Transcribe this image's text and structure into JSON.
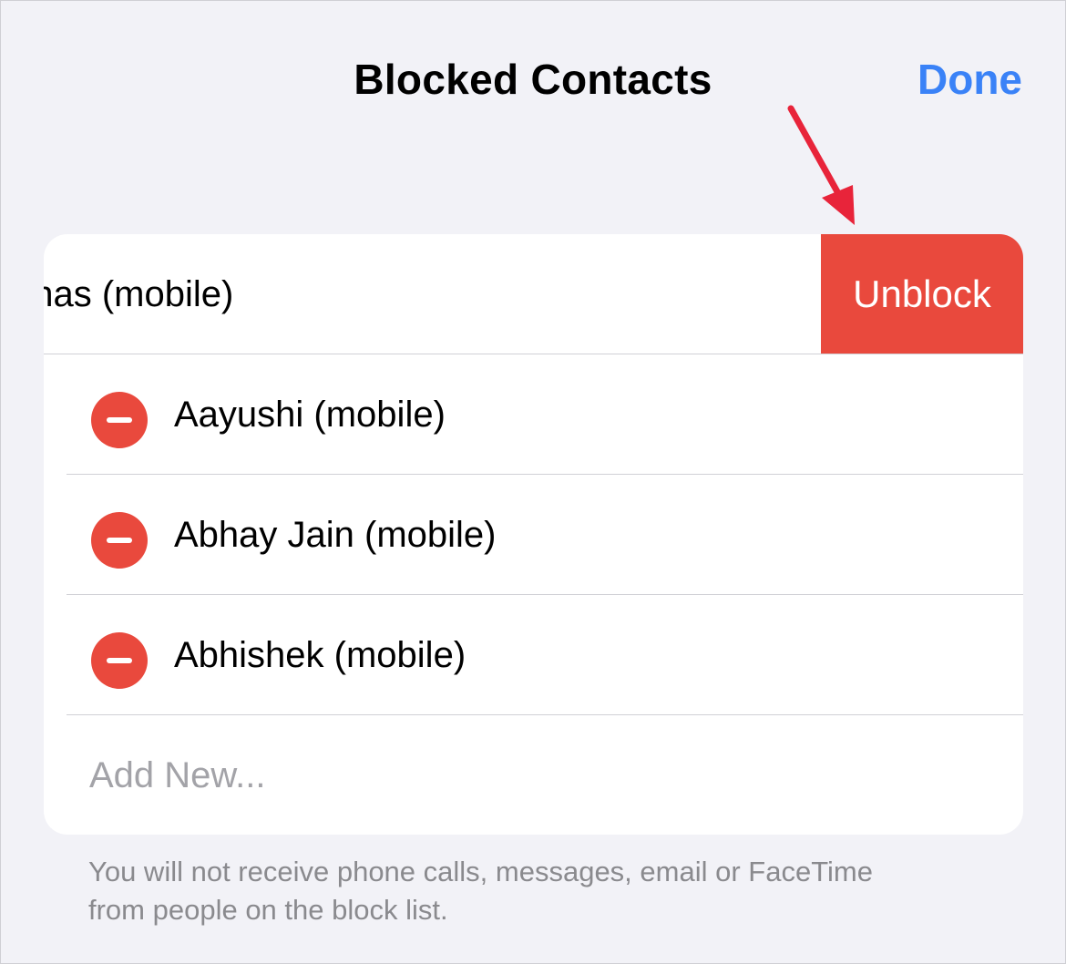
{
  "nav": {
    "title": "Blocked Contacts",
    "done_label": "Done"
  },
  "swiped_row": {
    "label": "ohas (mobile)",
    "action_label": "Unblock"
  },
  "contacts": [
    {
      "label": "Aayushi (mobile)"
    },
    {
      "label": "Abhay Jain (mobile)"
    },
    {
      "label": "Abhishek (mobile)"
    }
  ],
  "add_new_label": "Add New...",
  "footer_note": "You will not receive phone calls, messages, email or FaceTime from people on the block list.",
  "colors": {
    "background": "#f2f2f7",
    "accent_blue": "#3a82f7",
    "destructive_red": "#e9493d",
    "annotation_arrow": "#e8243a"
  }
}
